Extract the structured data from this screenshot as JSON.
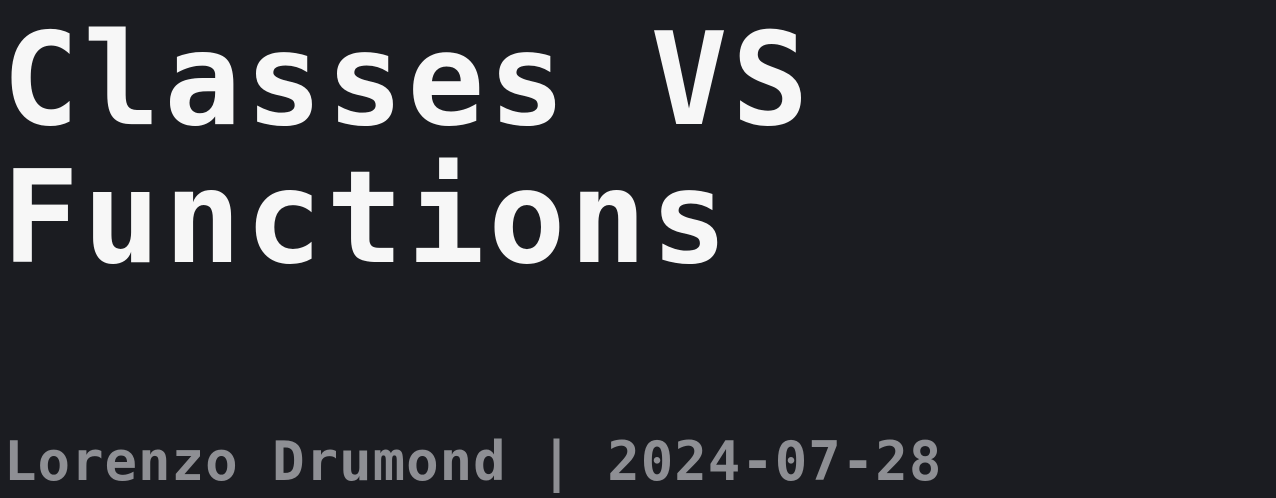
{
  "title": {
    "line1": "Classes VS",
    "line2": "Functions"
  },
  "byline": {
    "author": "Lorenzo Drumond",
    "separator": "|",
    "date": "2024-07-28"
  },
  "colors": {
    "background": "#1b1c21",
    "title": "#f7f7f7",
    "byline": "#8e8f94"
  }
}
